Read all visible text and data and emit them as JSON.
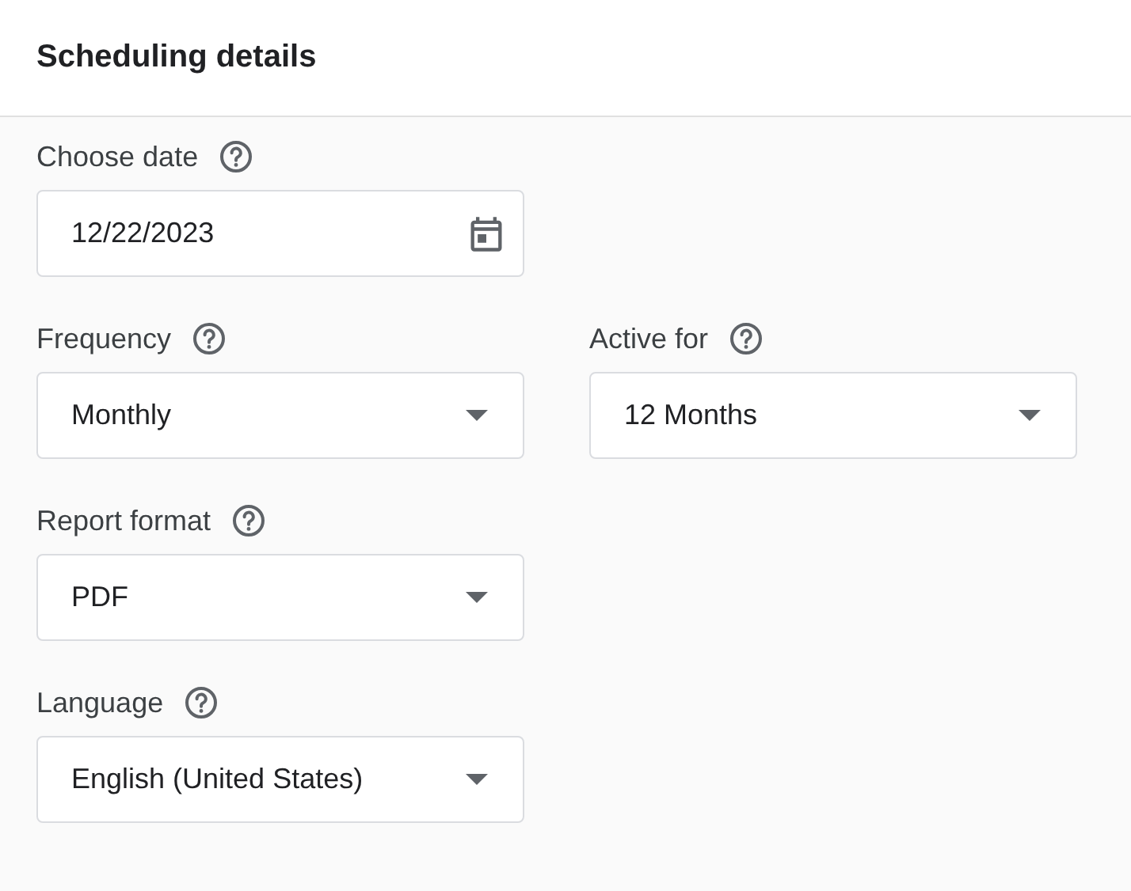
{
  "header": {
    "title": "Scheduling details"
  },
  "rows": [
    [
      {
        "label": "Choose date",
        "kind": "date",
        "value": "12/22/2023"
      }
    ],
    [
      {
        "label": "Frequency",
        "kind": "select",
        "value": "Monthly"
      },
      {
        "label": "Active for",
        "kind": "select",
        "value": "12 Months"
      }
    ],
    [
      {
        "label": "Report format",
        "kind": "select",
        "value": "PDF"
      }
    ],
    [
      {
        "label": "Language",
        "kind": "select",
        "value": "English (United States)"
      }
    ]
  ]
}
